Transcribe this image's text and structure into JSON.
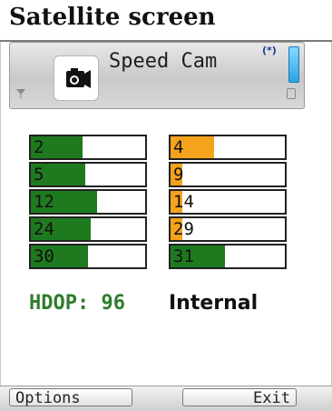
{
  "header": {
    "title": "Satellite screen"
  },
  "app": {
    "name": "Speed Cam",
    "icon": "camera-icon"
  },
  "status": {
    "bluetooth": "(*)",
    "battery_count": "0"
  },
  "satellites_left": [
    {
      "id": "2",
      "signal": 0.45,
      "color": "#1f7a1f"
    },
    {
      "id": "5",
      "signal": 0.48,
      "color": "#1f7a1f"
    },
    {
      "id": "12",
      "signal": 0.58,
      "color": "#1f7a1f"
    },
    {
      "id": "24",
      "signal": 0.52,
      "color": "#1f7a1f"
    },
    {
      "id": "30",
      "signal": 0.5,
      "color": "#1f7a1f"
    }
  ],
  "satellites_right": [
    {
      "id": "4",
      "signal": 0.38,
      "color": "#f5a21c"
    },
    {
      "id": "9",
      "signal": 0.1,
      "color": "#f5a21c"
    },
    {
      "id": "14",
      "signal": 0.1,
      "color": "#f5a21c"
    },
    {
      "id": "29",
      "signal": 0.1,
      "color": "#f5a21c"
    },
    {
      "id": "31",
      "signal": 0.48,
      "color": "#1f7a1f"
    }
  ],
  "hdop": {
    "text": "HDOP: 96"
  },
  "gps_source": {
    "text": "Internal"
  },
  "softkeys": {
    "left": "Options",
    "right": "Exit"
  },
  "colors": {
    "good": "#1f7a1f",
    "weak": "#f5a21c",
    "hdop": "#2f7d2c"
  }
}
